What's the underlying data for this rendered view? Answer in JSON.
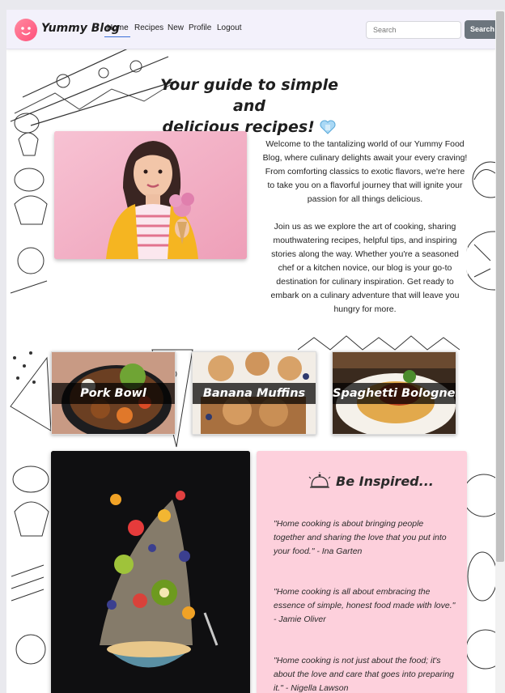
{
  "nav": {
    "brand": "Yummy Blog",
    "links": [
      "Home",
      "Recipes",
      "New",
      "Profile",
      "Logout"
    ],
    "search_placeholder": "Search",
    "search_button": "Search"
  },
  "hero": {
    "title_line1": "Your guide to simple and",
    "title_line2": "delicious recipes!",
    "intro_p1": "Welcome to the tantalizing world of our Yummy Food Blog, where culinary delights await your every craving! From comforting classics to exotic flavors, we're here to take you on a flavorful journey that will ignite your passion for all things delicious.",
    "intro_p2": "Join us as we explore the art of cooking, sharing mouthwatering recipes, helpful tips, and inspiring stories along the way. Whether you're a seasoned chef or a kitchen novice, our blog is your go-to destination for culinary inspiration. Get ready to embark on a culinary adventure that will leave you hungry for more."
  },
  "cards": [
    {
      "label": "Pork Bowl"
    },
    {
      "label": "Banana Muffins"
    },
    {
      "label": "Spaghetti Bolognese"
    }
  ],
  "inspired": {
    "title": "Be Inspired...",
    "quotes": [
      "\"Home cooking is about bringing people together and sharing the love that you put into your food.\" - Ina Garten",
      "\"Home cooking is all about embracing the essence of simple, honest food made with love.\" - Jamie Oliver",
      "\"Home cooking is not just about the food; it's about the love and care that goes into preparing it.\" - Nigella Lawson"
    ]
  },
  "colors": {
    "nav_bg": "#f3f1fb",
    "accent_pink": "#fdd0dc",
    "search_button": "#6c757d",
    "active_underline": "#3a6fd8"
  }
}
